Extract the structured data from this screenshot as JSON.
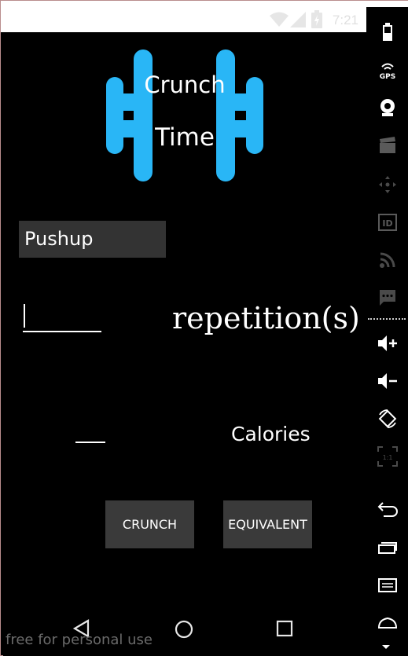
{
  "status_bar": {
    "time": "7:21"
  },
  "app": {
    "logo": {
      "line1": "Crunch",
      "line2": "Time",
      "color": "#29b6f6"
    },
    "exercise_value": "Pushup",
    "reps_value": "",
    "reps_label": "repetition(s)",
    "calories_value": "",
    "calories_label": "Calories",
    "buttons": {
      "crunch": "CRUNCH",
      "equivalent": "EQUIVALENT"
    }
  },
  "nav": {
    "back_icon": "back-triangle",
    "home_icon": "home-circle",
    "recents_icon": "recents-square"
  },
  "watermark": "free for personal use",
  "emulator_sidebar": {
    "items": [
      "power",
      "GPS",
      "camera",
      "clapper",
      "dpad",
      "ID",
      "rss",
      "sms",
      "volume-up",
      "volume-down",
      "rotate",
      "scale",
      "back",
      "recents",
      "menu",
      "home"
    ],
    "gps_label": "GPS",
    "id_label": "ID",
    "scale_label": "1:1"
  }
}
